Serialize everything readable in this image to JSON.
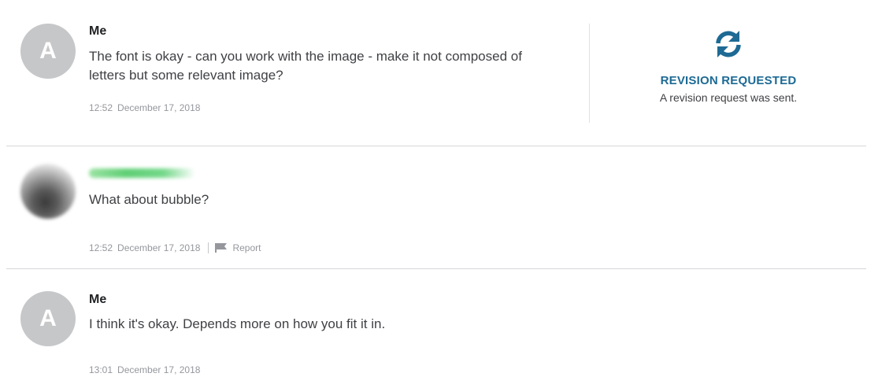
{
  "messages": [
    {
      "avatar_letter": "A",
      "sender": "Me",
      "text": "The font is okay - can you work with the image - make it not composed of letters but some relevant image?",
      "time": "12:52",
      "date": "December 17, 2018"
    },
    {
      "text": "What about bubble?",
      "time": "12:52",
      "date": "December 17, 2018",
      "report_label": "Report"
    },
    {
      "avatar_letter": "A",
      "sender": "Me",
      "text": "I think it's okay. Depends more on how you fit it in.",
      "time": "13:01",
      "date": "December 17, 2018"
    }
  ],
  "revision": {
    "icon": "refresh-icon",
    "title": "REVISION REQUESTED",
    "subtitle": "A revision request was sent.",
    "color": "#1d6a94"
  },
  "colors": {
    "avatar_bg": "#c6c7c9",
    "text": "#404145",
    "meta": "#95979d"
  }
}
